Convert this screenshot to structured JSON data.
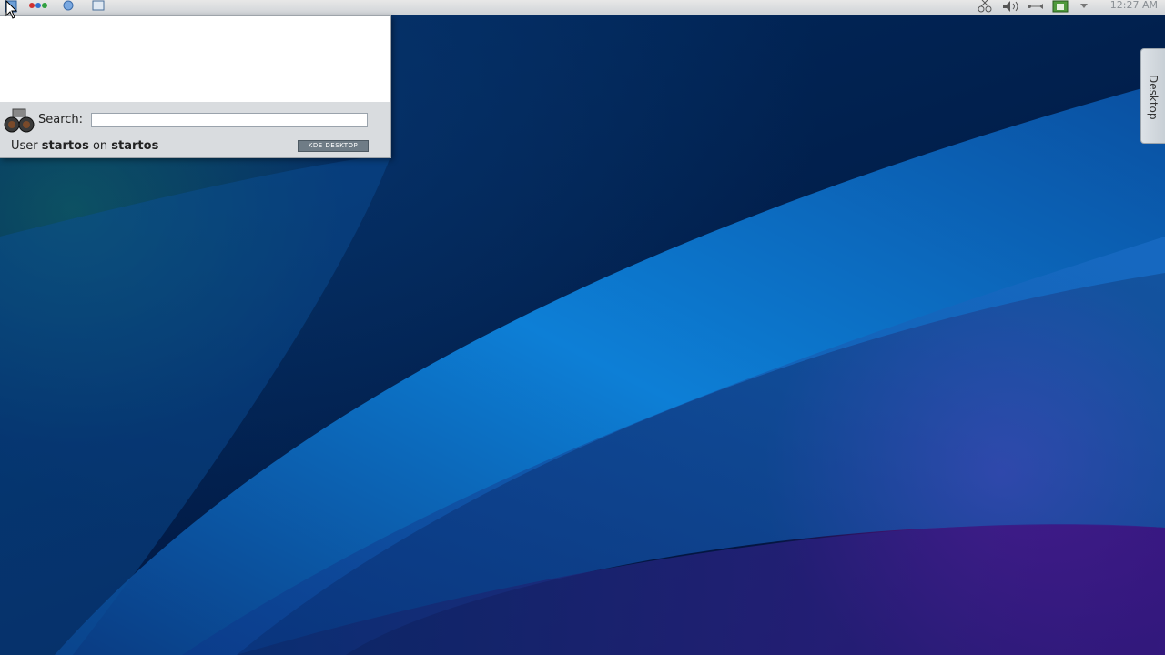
{
  "panel": {
    "clock": "12:27 AM",
    "icons": [
      "kde-menu-icon",
      "apps-icon",
      "network-icon",
      "notes-icon",
      "scissors-icon",
      "volume-icon",
      "usb-icon",
      "notes-tray-icon",
      "arrow-down-icon"
    ]
  },
  "launcher": {
    "search_label": "Search:",
    "search_value": "",
    "user_prefix": "User",
    "user_name": "startos",
    "user_mid": "on",
    "host_name": "startos",
    "badge": "KDE DESKTOP"
  },
  "desktop_tab": {
    "label": "Desktop"
  }
}
